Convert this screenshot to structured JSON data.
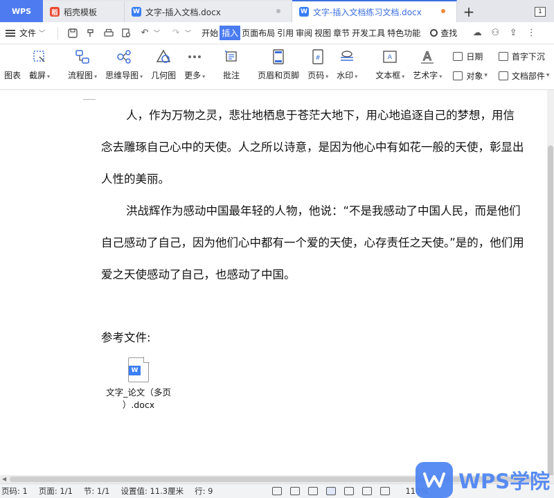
{
  "title_tabs": {
    "app": "WPS",
    "tab1": "稻壳模板",
    "tab2": "文字-插入文档.docx",
    "tab3": "文字-插入文档练习文档.docx",
    "new_tab": "+",
    "window_count": "1"
  },
  "menubar": {
    "file": "文件",
    "tabs": [
      "开始",
      "插入",
      "页面布局",
      "引用",
      "审阅",
      "视图",
      "章节",
      "开发工具",
      "特色功能"
    ],
    "active_tab": "插入",
    "search": "查找"
  },
  "ribbon": {
    "items": [
      {
        "label": "图表",
        "icon": "chart-icon"
      },
      {
        "label": "截屏",
        "icon": "screenshot-icon",
        "caret": true
      },
      {
        "label": "流程图",
        "icon": "flowchart-icon",
        "caret": true
      },
      {
        "label": "思维导图",
        "icon": "mindmap-icon",
        "caret": true
      },
      {
        "label": "几何图",
        "icon": "geometry-icon"
      },
      {
        "label": "更多",
        "icon": "more-icon",
        "caret": true
      },
      {
        "label": "批注",
        "icon": "comment-icon"
      },
      {
        "label": "页眉和页脚",
        "icon": "header-footer-icon"
      },
      {
        "label": "页码",
        "icon": "page-number-icon",
        "caret": true
      },
      {
        "label": "水印",
        "icon": "watermark-icon",
        "caret": true
      },
      {
        "label": "文本框",
        "icon": "textbox-icon",
        "caret": true
      },
      {
        "label": "艺术字",
        "icon": "wordart-icon",
        "caret": true
      }
    ],
    "small": [
      {
        "label": "日期",
        "icon": "date-icon"
      },
      {
        "label": "对象",
        "icon": "object-icon"
      },
      {
        "label": "首字下沉",
        "icon": "dropcap-icon"
      },
      {
        "label": "文档部件",
        "icon": "doc-parts-icon"
      }
    ]
  },
  "document": {
    "paragraph1": "人，作为万物之灵，悲壮地栖息于苍茫大地下，用心地追逐自己的梦想，用信念去雕琢自己心中的天使。人之所以诗意，是因为他心中有如花一般的天使，彰显出人性的美丽。",
    "paragraph2": "洪战辉作为感动中国最年轻的人物，他说：“不是我感动了中国人民，而是他们自己感动了自己，因为他们心中都有一个爱的天使，心存责任之天使。”是的，他们用爱之天使感动了自己，也感动了中国。",
    "reference_label": "参考文件:",
    "attachment": {
      "name_line1": "文字_论文（多页",
      "name_line2": "）.docx",
      "badge": "W"
    }
  },
  "statusbar": {
    "page_no": "页码: 1",
    "pages": "页面: 1/1",
    "section": "节: 1/1",
    "setting": "设置值: 11.3厘米",
    "row": "行: 9",
    "zoom": "110%"
  },
  "watermark": {
    "text": "WPS学院"
  },
  "colors": {
    "accent": "#4a7cf0",
    "wps_blue": "#4c84f3"
  }
}
